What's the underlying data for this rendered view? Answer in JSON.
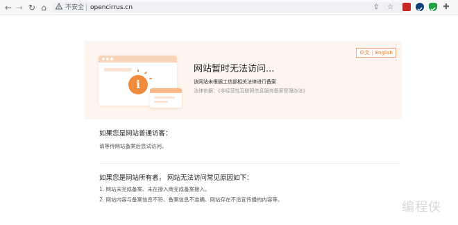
{
  "browser": {
    "back_glyph": "←",
    "forward_glyph": "→",
    "reload_glyph": "↻",
    "home_glyph": "⌂",
    "security_label": "不安全",
    "url": "opencirrus.cn",
    "share_glyph": "⇪",
    "star_glyph": "☆",
    "puzzle_glyph": "✚"
  },
  "banner": {
    "lang_zh": "中文",
    "lang_sep": "|",
    "lang_en": "English",
    "info_glyph": "i",
    "title": "网站暂时无法访问...",
    "line1": "该网站未根据工信部相关法律进行备案",
    "line2": "法律依据：《非经营性互联网信息服务备案管理办法》"
  },
  "visitor": {
    "heading": "如果您是网站普通访客：",
    "text": "请等待网站备案后尝试访问。"
  },
  "owner": {
    "heading": "如果您是网站所有者， 网站无法访问常见原因如下：",
    "items": [
      "1. 网站未完成备案、未在接入商完成备案接入。",
      "2. 网站内容与备案信息不符、备案信息不准确、网站存在不适宜传播的内容等。"
    ]
  },
  "watermark": "编程侠",
  "colors": {
    "accent": "#f08a3c",
    "banner_bg": "#fdf5ef",
    "lang_border": "#f3a672"
  }
}
